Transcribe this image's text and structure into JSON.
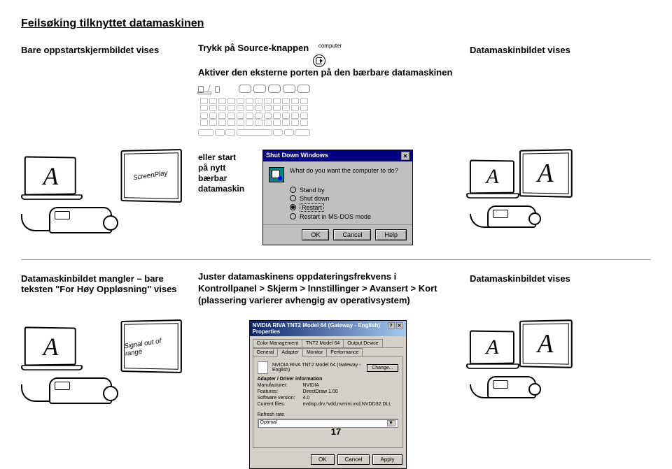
{
  "page": {
    "title": "Feilsøking tilknyttet datamaskinen",
    "number": "17"
  },
  "row1": {
    "left_heading": "Bare oppstartskjermbildet vises",
    "mid_line1": "Trykk på Source-knappen",
    "computer_label": "computer",
    "mid_line2": "Aktiver den eksterne porten på den bærbare datamaskinen",
    "right_heading": "Datamaskinbildet vises"
  },
  "illus1": {
    "screenplay": "ScreenPlay",
    "letter_a": "A",
    "restart": {
      "l1": "eller start",
      "l2": "på nytt",
      "l3": "bærbar",
      "l4": "datamaskin"
    },
    "shutdown_dialog": {
      "title": "Shut Down Windows",
      "question": "What do you want the computer to do?",
      "opt1": "Stand by",
      "opt2": "Shut down",
      "opt3": "Restart",
      "opt4": "Restart in MS-DOS mode",
      "btn_ok": "OK",
      "btn_cancel": "Cancel",
      "btn_help": "Help"
    }
  },
  "row2": {
    "left_heading": "Datamaskinbildet mangler – bare teksten \"For Høy Oppløsning\" vises",
    "mid_heading": "Juster datamaskinens oppdateringsfrekvens i Kontrollpanel > Skjerm > Innstillinger > Avansert > Kort (plassering varierer avhengig av operativsystem)",
    "right_heading": "Datamaskinbildet vises"
  },
  "illus2": {
    "letter_a": "A",
    "signal_out": "Signal out of range",
    "props_dialog": {
      "title": "NVIDIA RIVA TNT2 Model 64 (Gateway - English) Properties",
      "tab1": "Color Management",
      "tab2": "TNT2 Model 64",
      "tab3": "Output Device",
      "tab4": "General",
      "tab5": "Adapter",
      "tab6": "Monitor",
      "tab7": "Performance",
      "adapter_name": "NVIDIA RIVA TNT2 Model 64 (Gateway - English)",
      "section_info": "Adapter / Driver information",
      "lbl_manuf": "Manufacturer:",
      "val_manuf": "NVIDIA",
      "lbl_feat": "Features:",
      "val_feat": "DirectDraw 1.00",
      "lbl_sw": "Software version:",
      "val_sw": "4.0",
      "lbl_files": "Current files:",
      "val_files": "nvdisp.drv,*vdd,nvmini.vxd,NVDD32.DLL",
      "btn_change": "Change...",
      "rate_label": "Refresh rate",
      "rate_value": "Optimal",
      "btn_ok": "OK",
      "btn_cancel": "Cancel",
      "btn_apply": "Apply"
    }
  }
}
